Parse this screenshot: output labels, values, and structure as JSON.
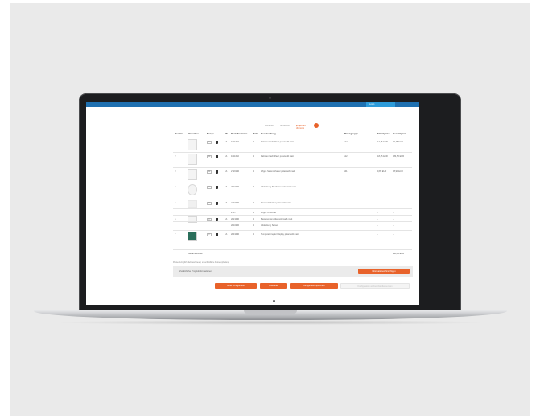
{
  "colors": {
    "accent": "#e8622a",
    "topbar": "#1f70b0",
    "login": "#2d9bd9",
    "backdrop": "#eaeaea"
  },
  "header": {
    "login_label": "Login"
  },
  "steps": [
    {
      "label": "Rahmen"
    },
    {
      "label": "Einsätze"
    },
    {
      "label": "Ergebnis",
      "sub": "Übersicht",
      "badge_icon": "check-icon"
    }
  ],
  "table": {
    "headers": [
      "Position",
      "Vorschau",
      "Menge",
      "NE",
      "Bestellnummer",
      "Teile",
      "Beschreibung",
      "Warengruppe",
      "Einzelpreis",
      "Gesamtpreis"
    ],
    "rows": [
      {
        "pos": "1",
        "qty": "1",
        "nr": "1/1",
        "art": "1011650",
        "tot": "1",
        "desc": "Rahmen flach 1fach polarweiß matt",
        "grp": "E12",
        "ep": "12,45 EUR",
        "gp": "12,45 EUR"
      },
      {
        "pos": "2",
        "qty": "10",
        "nr": "1/1",
        "art": "1011660",
        "tot": "1",
        "desc": "Rahmen flach 2fach polarweiß matt",
        "grp": "E12",
        "ep": "18,45 EUR",
        "gp": "184,50 EUR"
      },
      {
        "pos": "3",
        "qty": "10",
        "nr": "1/1",
        "art": "2720190",
        "tot": "1",
        "desc": "Wippe Serienschalter polarweiß matt",
        "grp": "E01",
        "ep": "9,89 EUR",
        "gp": "98,90 EUR"
      },
      {
        "pos": "4",
        "qty": "2",
        "nr": "1/1",
        "art": "2810200",
        "tot": "1",
        "desc": "Abdeckung Steckdose polarweiß matt",
        "grp": "",
        "ep": "-",
        "gp": "-"
      },
      {
        "pos": "5",
        "qty": "10",
        "nr": "1/1",
        "art": "2101020",
        "tot": "1",
        "desc": "Einsatz Schalter polarweiß matt",
        "grp": "",
        "ep": "-",
        "gp": "-"
      },
      {
        "pos": "",
        "qty": "",
        "nr": "",
        "art": "2107",
        "tot": "1",
        "desc": "Wippe Universal",
        "grp": "",
        "ep": "-",
        "gp": "-"
      },
      {
        "pos": "6",
        "qty": "2",
        "nr": "1/1",
        "art": "2821040",
        "tot": "1",
        "desc": "Bewegungsmelder polarweiß matt",
        "grp": "",
        "ep": "-",
        "gp": "-"
      },
      {
        "pos": "",
        "qty": "",
        "nr": "",
        "art": "2810200",
        "tot": "1",
        "desc": "Abdeckung Sensor",
        "grp": "",
        "ep": "-",
        "gp": "-"
      },
      {
        "pos": "7",
        "qty": "2",
        "nr": "1/1",
        "art": "2831040",
        "tot": "1",
        "desc": "Temperaturregler Display polarweiß matt",
        "grp": "",
        "ep": "-",
        "gp": "-"
      }
    ],
    "subtotal_label": "Gesamtsumme",
    "subtotal_value": "295,85 EUR"
  },
  "note": "Preise zuzüglich Mehrwertsteuer, unverbindliche Preisempfehlung",
  "request_bar": {
    "label": "Zusätzliche Projektinformationen",
    "button": "Informationen hinzufügen"
  },
  "actions": {
    "new_config": "Neue Konfiguration",
    "download": "Download",
    "save_config": "Konfiguration speichern",
    "send_disabled": "Konfiguration an Fachhändler senden"
  }
}
